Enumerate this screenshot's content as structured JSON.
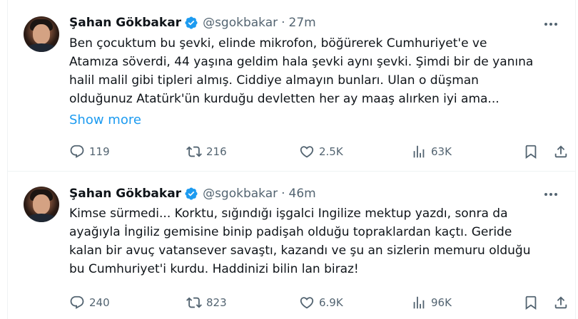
{
  "tweets": [
    {
      "author": {
        "name": "Şahan Gökbakar",
        "handle": "@sgokbakar"
      },
      "separator": "·",
      "time": "27m",
      "lines": [
        "Ben çocuktum bu şevki, elinde mikrofon, böğürerek Cumhuriyet'e ve",
        "Atamıza söverdi, 44 yaşına geldim hala şevki aynı şevki. Şimdi bir de yanına",
        "halil malil gibi tipleri almış. Ciddiye almayın bunları. Ulan o düşman",
        "olduğunuz Atatürk'ün kurduğu devletten her ay maaş alırken iyi ama..."
      ],
      "show_more": "Show more",
      "stats": {
        "replies": "119",
        "reposts": "216",
        "likes": "2.5K",
        "views": "63K"
      }
    },
    {
      "author": {
        "name": "Şahan Gökbakar",
        "handle": "@sgokbakar"
      },
      "separator": "·",
      "time": "46m",
      "lines": [
        "Kimse sürmedi... Korktu, sığındığı işgalci Ingilize mektup yazdı, sonra da",
        "ayağıyla İngiliz gemisine binip padişah olduğu topraklardan kaçtı. Geride",
        "kalan bir avuç vatansever savaştı, kazandı ve şu an sizlerin memuru olduğu",
        "bu Cumhuriyet'i kurdu. Haddinizi bilin lan biraz!"
      ],
      "stats": {
        "replies": "240",
        "reposts": "823",
        "likes": "6.9K",
        "views": "96K"
      }
    }
  ],
  "colors": {
    "accent": "#1d9bf0",
    "muted": "#536471",
    "text": "#0f1419"
  },
  "icons": [
    "verified-badge-icon",
    "more-icon",
    "reply-icon",
    "repost-icon",
    "like-icon",
    "views-icon",
    "bookmark-icon",
    "share-icon"
  ]
}
